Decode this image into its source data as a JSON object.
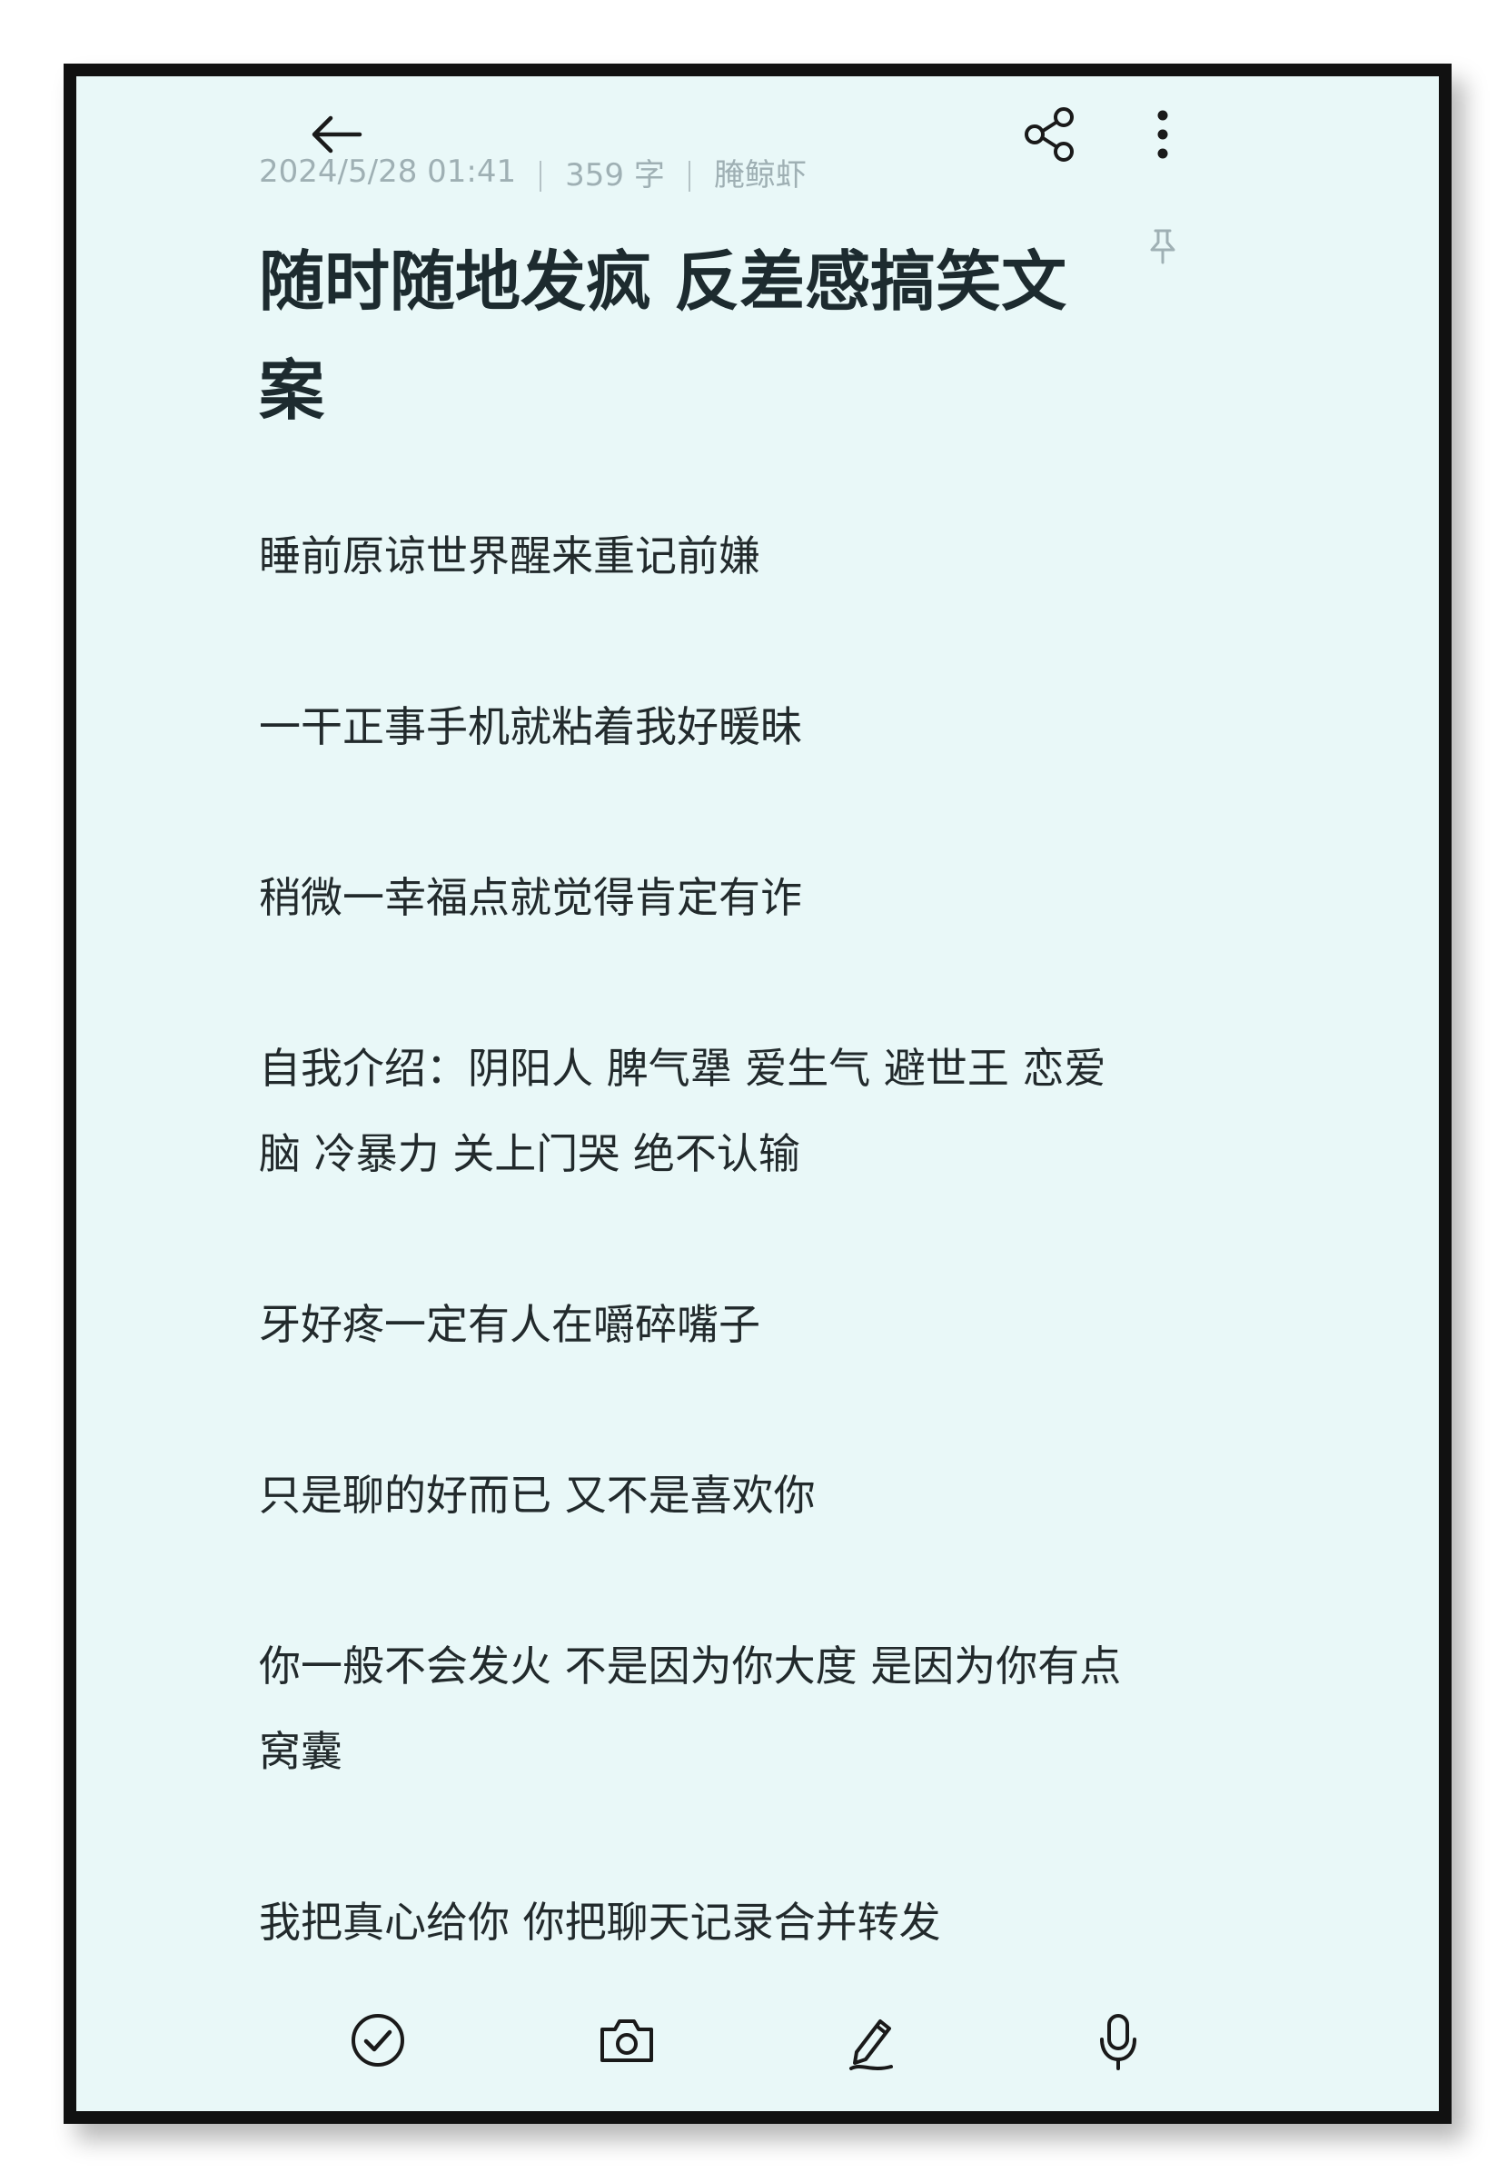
{
  "header": {
    "back_icon": "arrow-left-icon",
    "share_icon": "share-icon",
    "more_icon": "more-vertical-icon"
  },
  "meta": {
    "datetime": "2024/5/28 01:41",
    "word_count": "359 字",
    "author": "腌鲸虾",
    "pin_icon": "pin-icon"
  },
  "note": {
    "title": "随时随地发疯 反差感搞笑文案",
    "paragraphs": [
      "睡前原谅世界醒来重记前嫌",
      "一干正事手机就粘着我好暖昧",
      "稍微一幸福点就觉得肯定有诈",
      "自我介绍：阴阳人 脾气犟 爱生气 避世王 恋爱脑 冷暴力 关上门哭 绝不认输",
      "牙好疼一定有人在嚼碎嘴子",
      "只是聊的好而已 又不是喜欢你",
      "你一般不会发火 不是因为你大度 是因为你有点窝囊",
      "我把真心给你 你把聊天记录合并转发"
    ]
  },
  "toolbar": {
    "items": [
      "checklist-icon",
      "camera-icon",
      "handwriting-icon",
      "microphone-icon"
    ]
  },
  "colors": {
    "background": "#e9f8f8",
    "frame": "#111111",
    "title_text": "#1d2b2f",
    "body_text": "#222a2c",
    "meta_text": "#9fb0b4"
  }
}
